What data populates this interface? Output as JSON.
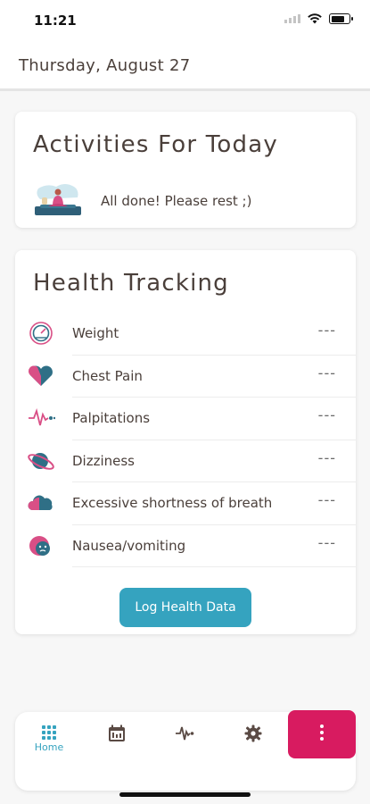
{
  "status_bar": {
    "time": "11:21"
  },
  "header": {
    "date": "Thursday, August 27"
  },
  "activities": {
    "title": "Activities For Today",
    "message": "All done! Please rest ;)"
  },
  "health_tracking": {
    "title": "Health Tracking",
    "items": [
      {
        "label": "Weight",
        "value": "---",
        "icon": "weight-scale-icon"
      },
      {
        "label": "Chest Pain",
        "value": "---",
        "icon": "heart-icon"
      },
      {
        "label": "Palpitations",
        "value": "---",
        "icon": "pulse-icon"
      },
      {
        "label": "Dizziness",
        "value": "---",
        "icon": "planet-icon"
      },
      {
        "label": "Excessive shortness of breath",
        "value": "---",
        "icon": "cloud-icon"
      },
      {
        "label": "Nausea/vomiting",
        "value": "---",
        "icon": "nausea-icon"
      }
    ],
    "button_label": "Log Health Data"
  },
  "nav": {
    "home_label": "Home",
    "items": [
      "home-grid-icon",
      "calendar-icon",
      "activity-icon",
      "settings-gear-icon",
      "more-menu-icon"
    ]
  },
  "colors": {
    "accent": "#35a3bf",
    "more_button": "#d81b60",
    "text": "#4a3f3a",
    "icon_pink": "#d94f86",
    "icon_teal": "#2f6f86"
  }
}
